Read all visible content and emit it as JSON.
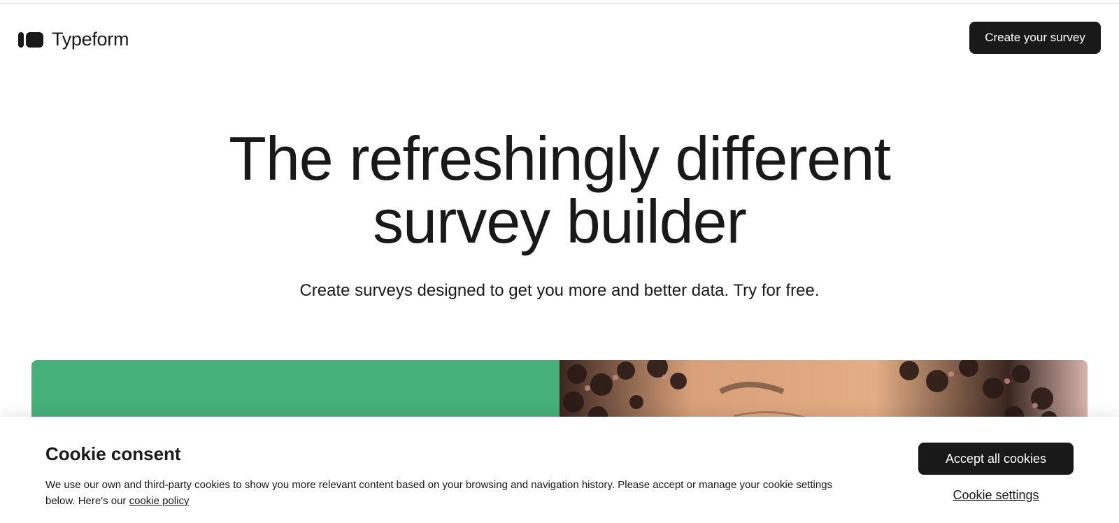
{
  "header": {
    "logo_text": "Typeform",
    "create_button": "Create your survey"
  },
  "hero": {
    "title_line1": "The refreshingly different",
    "title_line2": "survey builder",
    "subtitle": "Create surveys designed to get you more and better data. Try for free."
  },
  "media": {
    "panel_color": "#45b07a"
  },
  "cookie": {
    "title": "Cookie consent",
    "text": "We use our own and third-party cookies to show you more relevant content based on your browsing and navigation history. Please accept or manage your cookie settings below. Here's our ",
    "policy_link": "cookie policy",
    "accept_button": "Accept all cookies",
    "settings_link": "Cookie settings"
  },
  "colors": {
    "brand_dark": "#191919",
    "green_panel": "#45b07a"
  }
}
